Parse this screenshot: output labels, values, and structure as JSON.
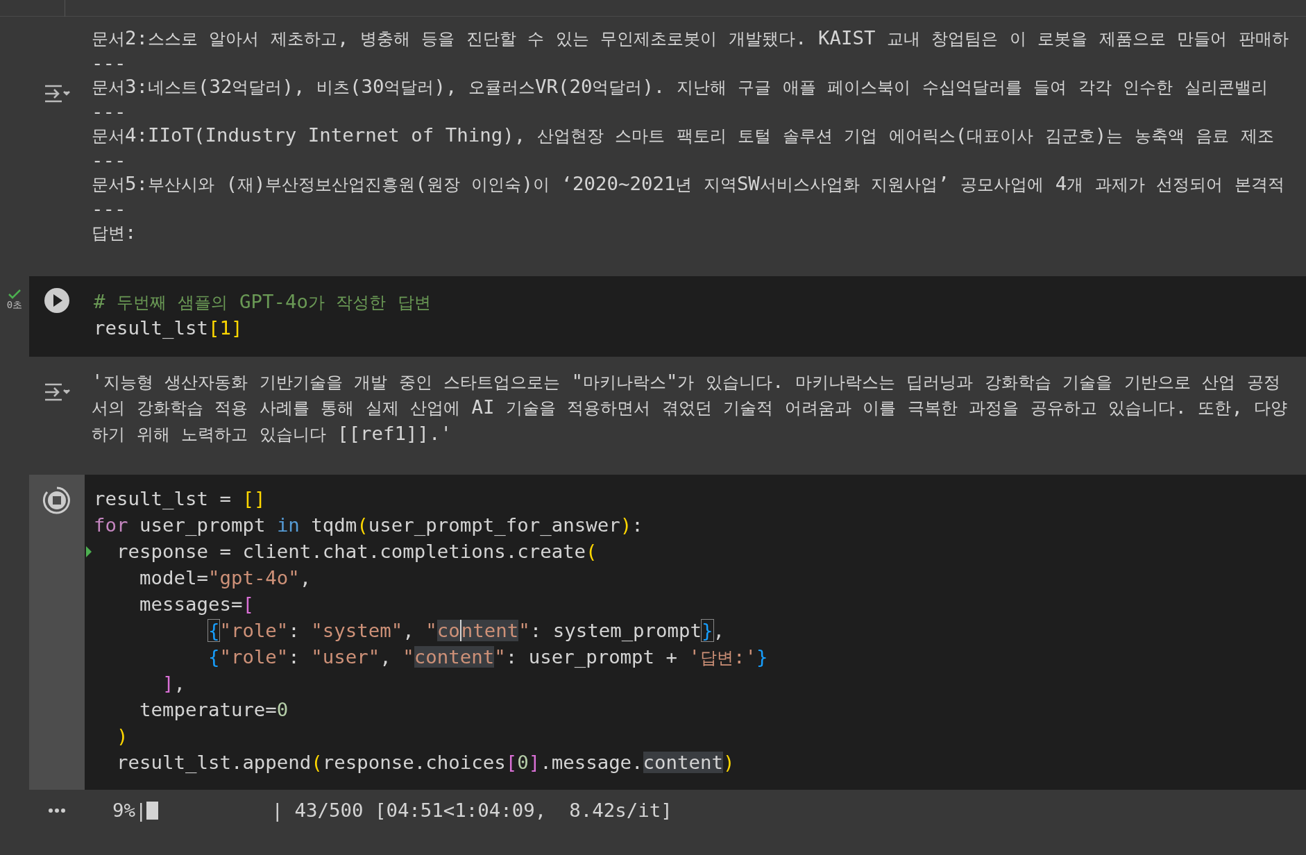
{
  "cells": [
    {
      "kind": "output",
      "lines": [
        "문서2:스스로 알아서 제초하고, 병충해 등을 진단할 수 있는 무인제초로봇이 개발됐다. KAIST 교내 창업팀은 이 로봇을 제품으로 만들어 판매하",
        "---",
        "문서3:네스트(32억달러), 비츠(30억달러), 오큘러스VR(20억달러). 지난해 구글 애플 페이스북이 수십억달러를 들여 각각 인수한 실리콘밸리",
        "---",
        "문서4:IIoT(Industry Internet of Thing), 산업현장 스마트 팩토리 토털 솔루션 기업 에어릭스(대표이사 김군호)는 농축액 음료 제조",
        "---",
        "문서5:부산시와 (재)부산정보산업진흥원(원장 이인숙)이 ‘2020~2021년 지역SW서비스사업화 지원사업’ 공모사업에 4개 과제가 선정되어 본격적",
        "---",
        "답변:"
      ]
    },
    {
      "kind": "code",
      "running": false,
      "succeeded": true,
      "time": "0초",
      "lines": [
        {
          "tokens": [
            {
              "text": "# 두번째 샘플의 GPT-4o가 작성한 답변",
              "kind": "comment"
            }
          ]
        },
        {
          "tokens": [
            {
              "text": "result_lst",
              "kind": "plain"
            },
            {
              "text": "[1]",
              "kind": "bracket1"
            }
          ]
        }
      ]
    },
    {
      "kind": "output",
      "lines": [
        "'지능형 생산자동화 기반기술을 개발 중인 스타트업으로는 \"마키나락스\"가 있습니다. 마키나락스는 딥러닝과 강화학습 기술을 기반으로 산업 공정",
        "서의 강화학습 적용 사례를 통해 실제 산업에 AI 기술을 적용하면서 겪었던 기술적 어려움과 이를 극복한 과정을 공유하고 있습니다. 또한, 다양",
        "하기 위해 노력하고 있습니다 [[ref1]].'"
      ]
    },
    {
      "kind": "code",
      "running": true,
      "lines": [
        {
          "tokens": [
            {
              "text": "result_lst = ",
              "kind": "plain"
            },
            {
              "text": "[]",
              "kind": "bracket1"
            }
          ]
        },
        {
          "tokens": [
            {
              "text": "for",
              "kind": "control"
            },
            {
              "text": " user_prompt ",
              "kind": "plain"
            },
            {
              "text": "in",
              "kind": "keyword"
            },
            {
              "text": " tqdm",
              "kind": "plain"
            },
            {
              "text": "(",
              "kind": "bracket1"
            },
            {
              "text": "user_prompt_for_answer",
              "kind": "plain"
            },
            {
              "text": ")",
              "kind": "bracket1"
            },
            {
              "text": ":",
              "kind": "plain"
            }
          ]
        },
        {
          "current": true,
          "tokens": [
            {
              "text": "  response = client.chat.completions.create",
              "kind": "plain"
            },
            {
              "text": "(",
              "kind": "bracket1"
            }
          ]
        },
        {
          "tokens": [
            {
              "text": "    model=",
              "kind": "plain"
            },
            {
              "text": "\"gpt-4o\"",
              "kind": "string"
            },
            {
              "text": ",",
              "kind": "plain"
            }
          ]
        },
        {
          "tokens": [
            {
              "text": "    messages=",
              "kind": "plain"
            },
            {
              "text": "[",
              "kind": "bracket2"
            }
          ]
        },
        {
          "tokens": [
            {
              "text": "          {",
              "kind": "bracket3",
              "matched": true
            },
            {
              "text": "\"role\"",
              "kind": "string"
            },
            {
              "text": ": ",
              "kind": "plain"
            },
            {
              "text": "\"system\"",
              "kind": "string"
            },
            {
              "text": ", ",
              "kind": "plain"
            },
            {
              "text": "\"",
              "kind": "string"
            },
            {
              "text": "co",
              "kind": "string",
              "highlighted": true
            },
            {
              "text": "ntent",
              "kind": "string",
              "highlighted": true,
              "cursor": true
            },
            {
              "text": "\"",
              "kind": "string"
            },
            {
              "text": ": system_prompt",
              "kind": "plain"
            },
            {
              "text": "}",
              "kind": "bracket3",
              "matched": true
            },
            {
              "text": ",",
              "kind": "plain"
            }
          ]
        },
        {
          "tokens": [
            {
              "text": "          {",
              "kind": "bracket3"
            },
            {
              "text": "\"role\"",
              "kind": "string"
            },
            {
              "text": ": ",
              "kind": "plain"
            },
            {
              "text": "\"user\"",
              "kind": "string"
            },
            {
              "text": ", ",
              "kind": "plain"
            },
            {
              "text": "\"",
              "kind": "string"
            },
            {
              "text": "content",
              "kind": "string",
              "highlighted": true
            },
            {
              "text": "\"",
              "kind": "string"
            },
            {
              "text": ": user_prompt + ",
              "kind": "plain"
            },
            {
              "text": "'답변:'",
              "kind": "string"
            },
            {
              "text": "}",
              "kind": "bracket3"
            }
          ]
        },
        {
          "tokens": [
            {
              "text": "      ]",
              "kind": "bracket2"
            },
            {
              "text": ",",
              "kind": "plain"
            }
          ]
        },
        {
          "tokens": [
            {
              "text": "    temperature=",
              "kind": "plain"
            },
            {
              "text": "0",
              "kind": "number"
            }
          ]
        },
        {
          "tokens": [
            {
              "text": "  )",
              "kind": "bracket1"
            }
          ]
        },
        {
          "tokens": [
            {
              "text": "  result_lst.append",
              "kind": "plain"
            },
            {
              "text": "(",
              "kind": "bracket1"
            },
            {
              "text": "response.choices",
              "kind": "plain"
            },
            {
              "text": "[",
              "kind": "bracket2"
            },
            {
              "text": "0",
              "kind": "number"
            },
            {
              "text": "]",
              "kind": "bracket2"
            },
            {
              "text": ".message.",
              "kind": "plain"
            },
            {
              "text": "content",
              "kind": "plain",
              "highlighted": true
            },
            {
              "text": ")",
              "kind": "bracket1"
            }
          ]
        }
      ],
      "progress": {
        "percent": "9%|",
        "level": 0.09,
        "reading": "| 43/500 [04:51<1:04:09,  8.42s/it]"
      }
    }
  ]
}
